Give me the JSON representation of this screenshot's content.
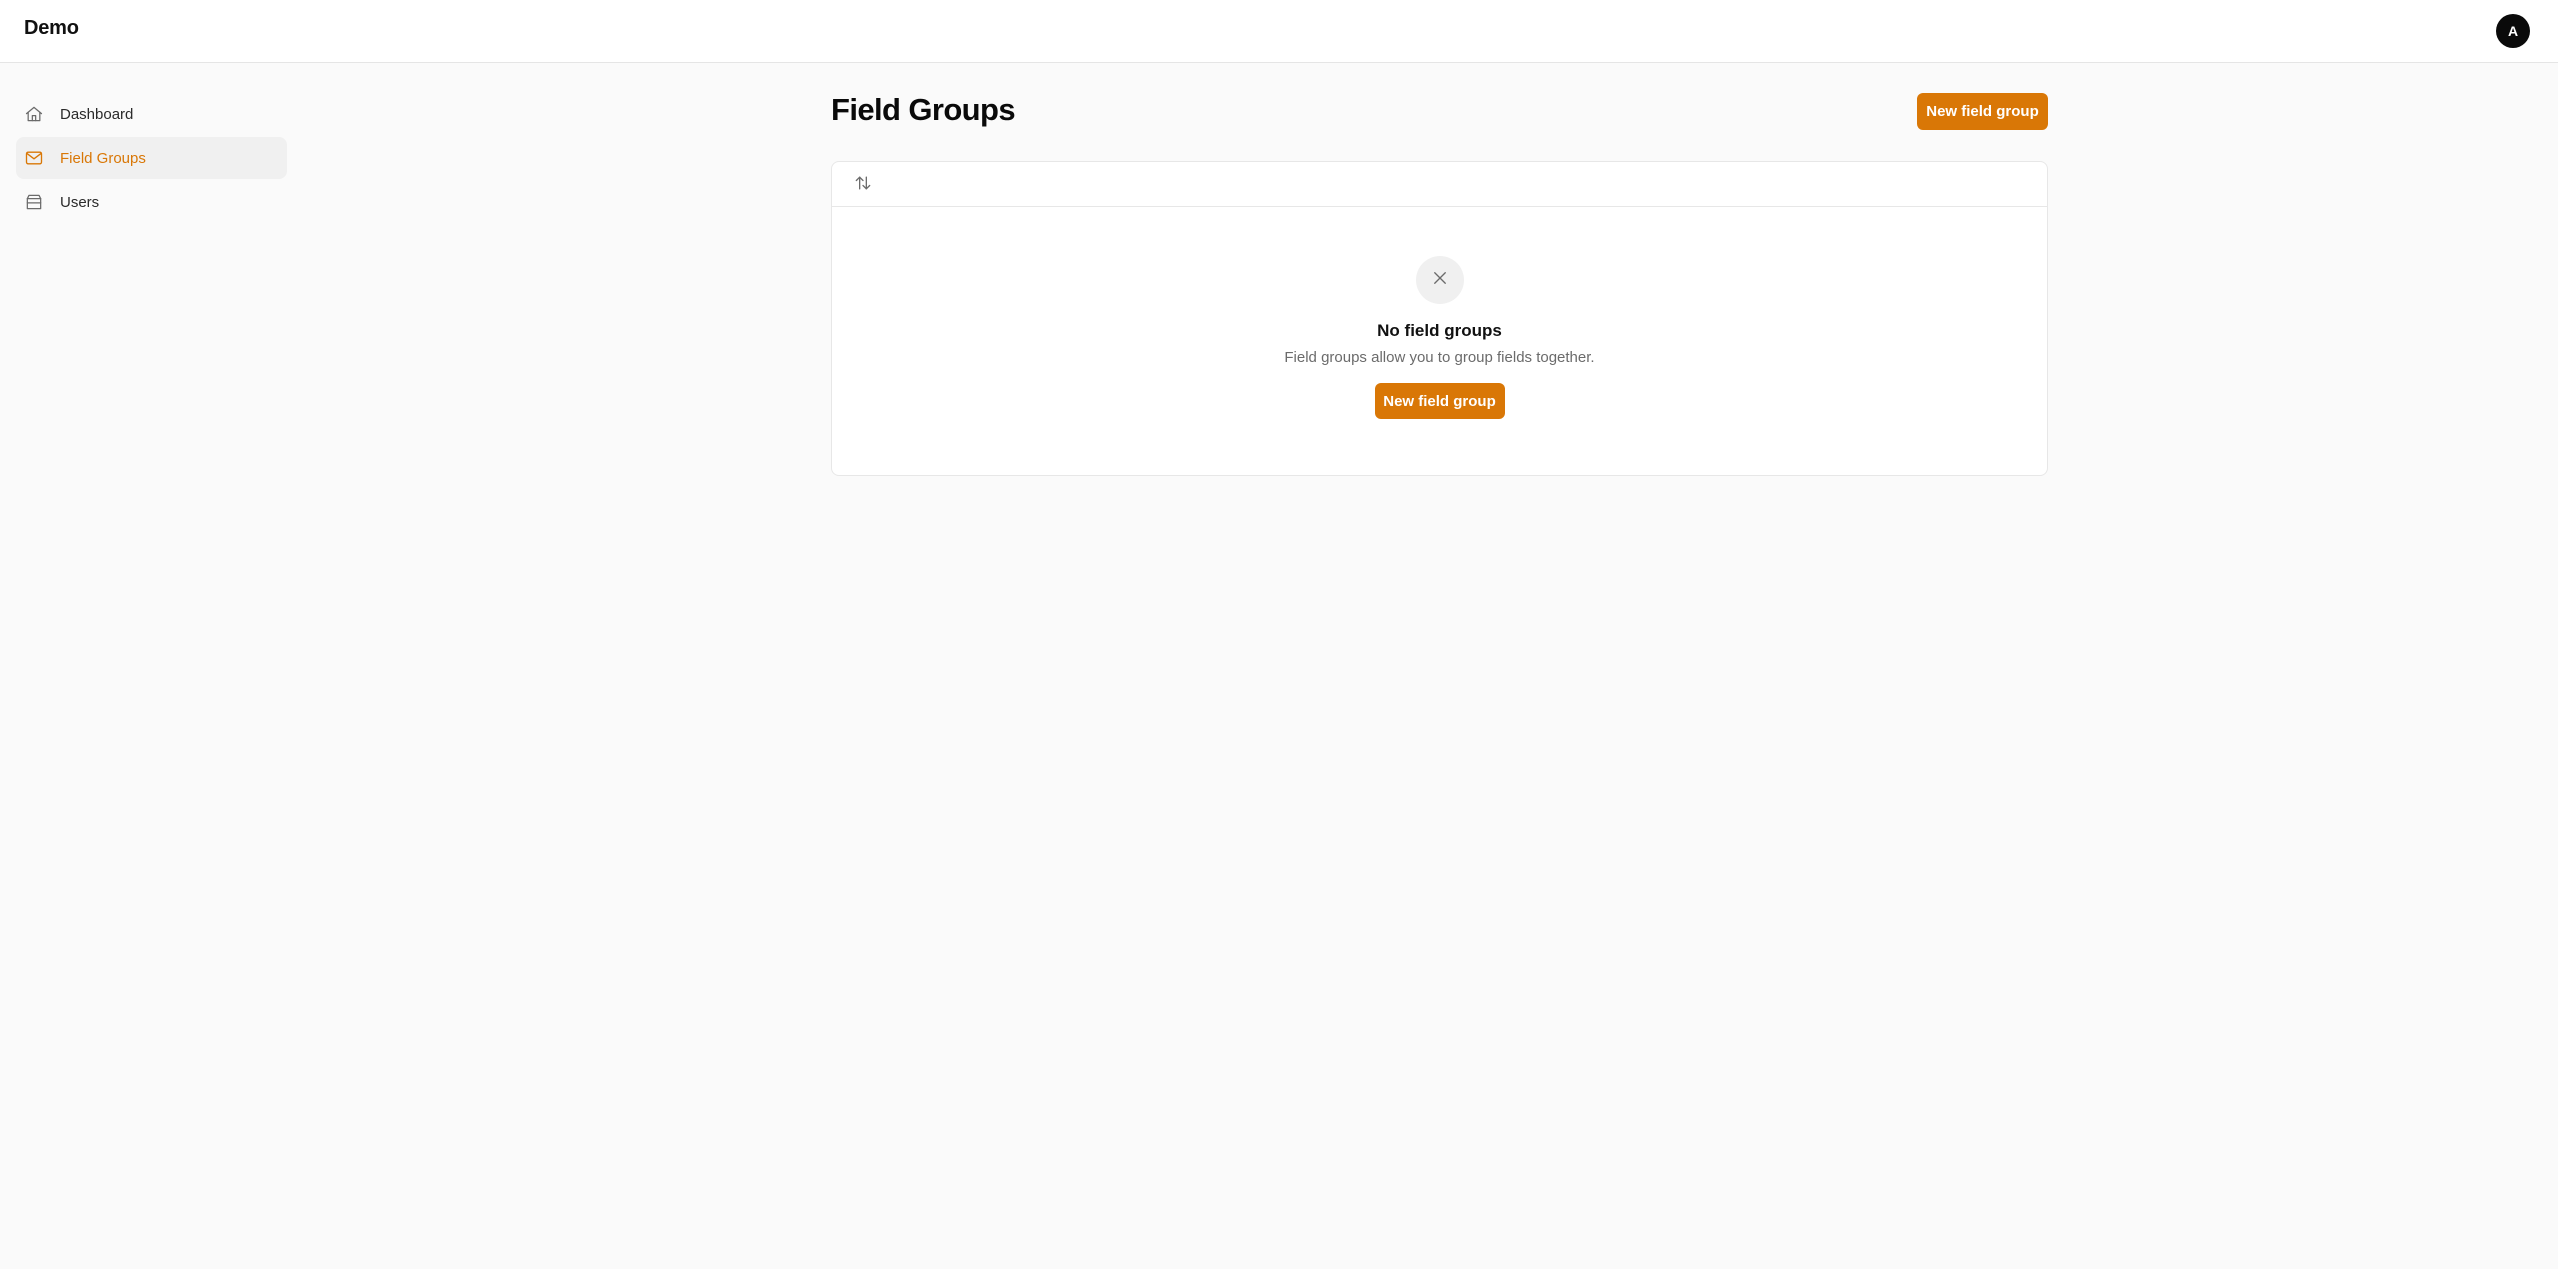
{
  "app": {
    "title": "Demo",
    "avatar_initial": "A"
  },
  "sidebar": {
    "items": [
      {
        "label": "Dashboard",
        "icon": "home-icon",
        "active": false
      },
      {
        "label": "Field Groups",
        "icon": "mail-icon",
        "active": true
      },
      {
        "label": "Users",
        "icon": "archive-box-icon",
        "active": false
      }
    ]
  },
  "main": {
    "page_title": "Field Groups",
    "new_button_label": "New field group",
    "toolbar": {
      "sort_icon": "sort-arrows-icon"
    },
    "empty_state": {
      "icon": "close-icon",
      "title": "No field groups",
      "description": "Field groups allow you to group fields together.",
      "button_label": "New field group"
    }
  },
  "colors": {
    "accent": "#d97706",
    "background": "#fafafa",
    "surface": "#ffffff",
    "border": "#e5e5e5"
  }
}
